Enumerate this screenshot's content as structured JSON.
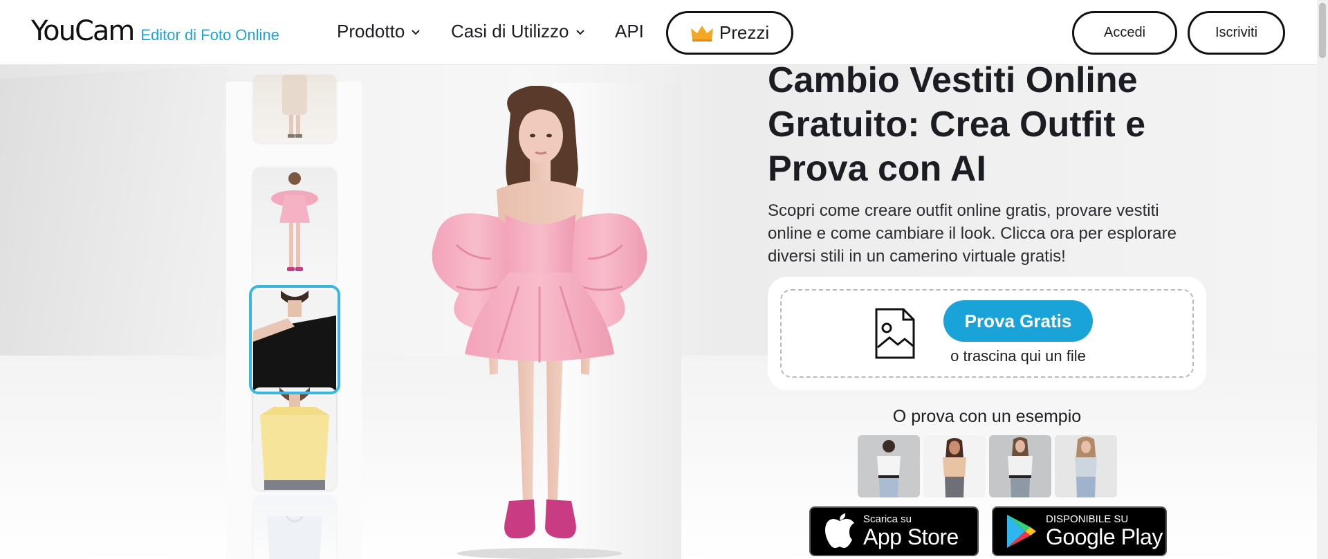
{
  "header": {
    "logo": "YouCam",
    "logo_sub": "Editor di Foto Online",
    "nav": [
      {
        "label": "Prodotto"
      },
      {
        "label": "Casi di Utilizzo"
      },
      {
        "label": "API"
      }
    ],
    "pricing": "Prezzi",
    "login": "Accedi",
    "signup": "Iscriviti"
  },
  "hero": {
    "title": "Cambio Vestiti Online Gratuito: Crea Outfit e Prova con AI",
    "description": "Scopri come creare outfit online gratis, provare vestiti online e come cambiare il look. Clicca ora per esplorare diversi stili in un camerino virtuale gratis!",
    "cta": "Prova Gratis",
    "drag_text": "o trascina qui un file",
    "example_label": "O prova con un esempio"
  },
  "stores": {
    "apple_small": "Scarica su",
    "apple_big": "App Store",
    "google_small": "DISPONIBILE SU",
    "google_big": "Google Play"
  },
  "colors": {
    "accent": "#1aa3d8",
    "selection": "#3ab7df",
    "dress": "#f3a9be",
    "shoes": "#c93b82"
  }
}
